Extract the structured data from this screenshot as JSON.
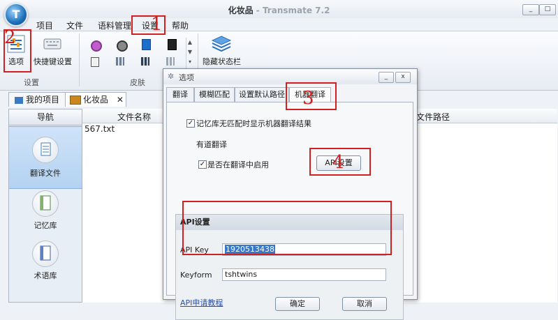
{
  "app": {
    "title": "化妆品",
    "subtitle": "- Transmate 7.2",
    "logo_letter": "T",
    "window_buttons": [
      "_",
      "□",
      "x"
    ]
  },
  "menu": {
    "items": [
      "项目",
      "文件",
      "语料管理",
      "设置",
      "帮助"
    ]
  },
  "ribbon": {
    "options_label": "选项",
    "shortcut_label": "快捷键设置",
    "settings_group_label": "设置",
    "skin_group_label": "皮肤",
    "hide_status_label": "隐藏状态栏"
  },
  "doc_tabs": [
    "我的项目",
    "化妆品"
  ],
  "nav": {
    "header": "导航",
    "items": [
      "翻译文件",
      "记忆库",
      "术语库"
    ]
  },
  "list": {
    "col_name": "文件名称",
    "col_path": "文件路径",
    "rows": [
      "567.txt"
    ]
  },
  "dialog": {
    "title": "选项",
    "tabs": [
      "翻译",
      "模糊匹配",
      "设置默认路径",
      "机器翻译"
    ],
    "memory_checkbox": "记忆库无匹配时显示机器翻译结果",
    "engine_label": "有道翻译",
    "enable_checkbox": "是否在翻译中启用",
    "api_button": "API设置",
    "api_section": "API设置",
    "api_key_label": "API Key",
    "api_key_value": "1920513438",
    "keyform_label": "Keyform",
    "keyform_value": "tshtwins",
    "help_link": "API申请教程",
    "ok": "确定",
    "cancel": "取消",
    "title_buttons": [
      "_",
      "x"
    ]
  },
  "annotations": [
    "1",
    "2",
    "3",
    "4"
  ],
  "colors": {
    "annotation_red": "#d21f1f",
    "accent_blue": "#2a6fc0"
  }
}
